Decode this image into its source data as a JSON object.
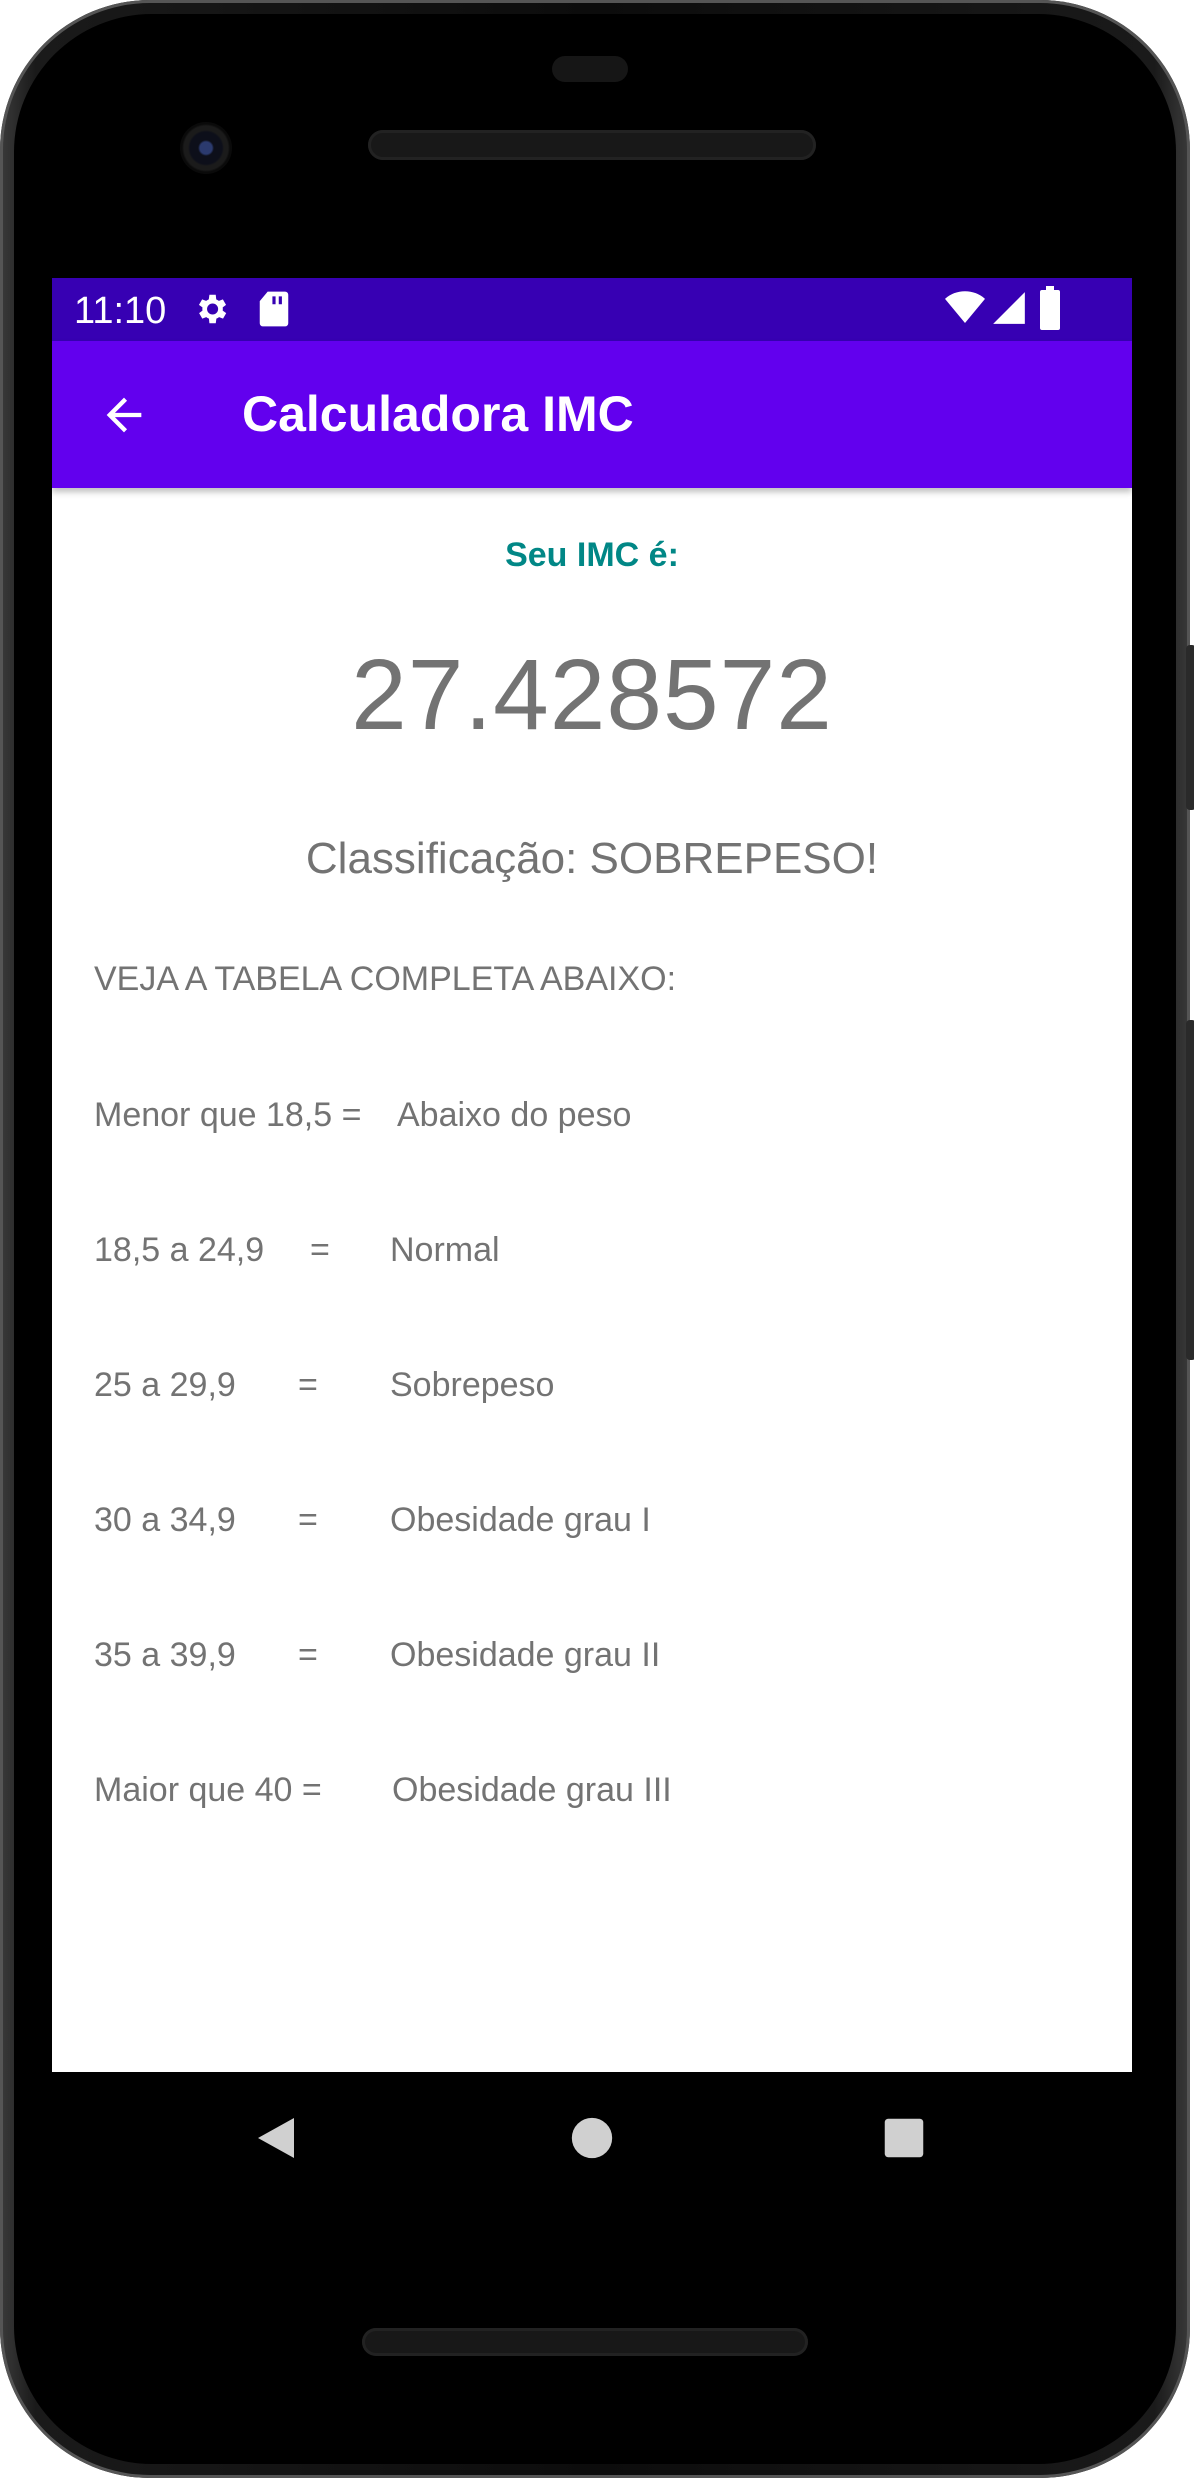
{
  "status_bar": {
    "time": "11:10",
    "icons": [
      "gear-icon",
      "sd-card-icon",
      "wifi-icon",
      "signal-icon",
      "battery-icon"
    ]
  },
  "app_bar": {
    "title": "Calculadora IMC",
    "back_icon": "arrow-back-icon"
  },
  "result": {
    "label": "Seu IMC é:",
    "value": "27.428572",
    "classification": "Classificação: SOBREPESO!"
  },
  "table": {
    "heading": "VEJA A TABELA COMPLETA ABAIXO:",
    "rows": [
      {
        "range": "Menor que 18,5 =",
        "equals": "",
        "classification": "Abaixo do peso"
      },
      {
        "range": "18,5 a 24,9",
        "equals": "=",
        "classification": "Normal"
      },
      {
        "range": "25 a 29,9",
        "equals": "=",
        "classification": "Sobrepeso"
      },
      {
        "range": "30 a 34,9",
        "equals": "=",
        "classification": "Obesidade grau I"
      },
      {
        "range": "35 a 39,9",
        "equals": "=",
        "classification": "Obesidade grau II"
      },
      {
        "range": "Maior que 40 =",
        "equals": "",
        "classification": "Obesidade grau III"
      }
    ]
  },
  "nav_bar": {
    "buttons": [
      "back-triangle-icon",
      "home-circle-icon",
      "recents-square-icon"
    ]
  },
  "colors": {
    "status_bar": "#3700b3",
    "app_bar": "#6200ee",
    "accent_text": "#018786",
    "body_text": "#737373"
  }
}
